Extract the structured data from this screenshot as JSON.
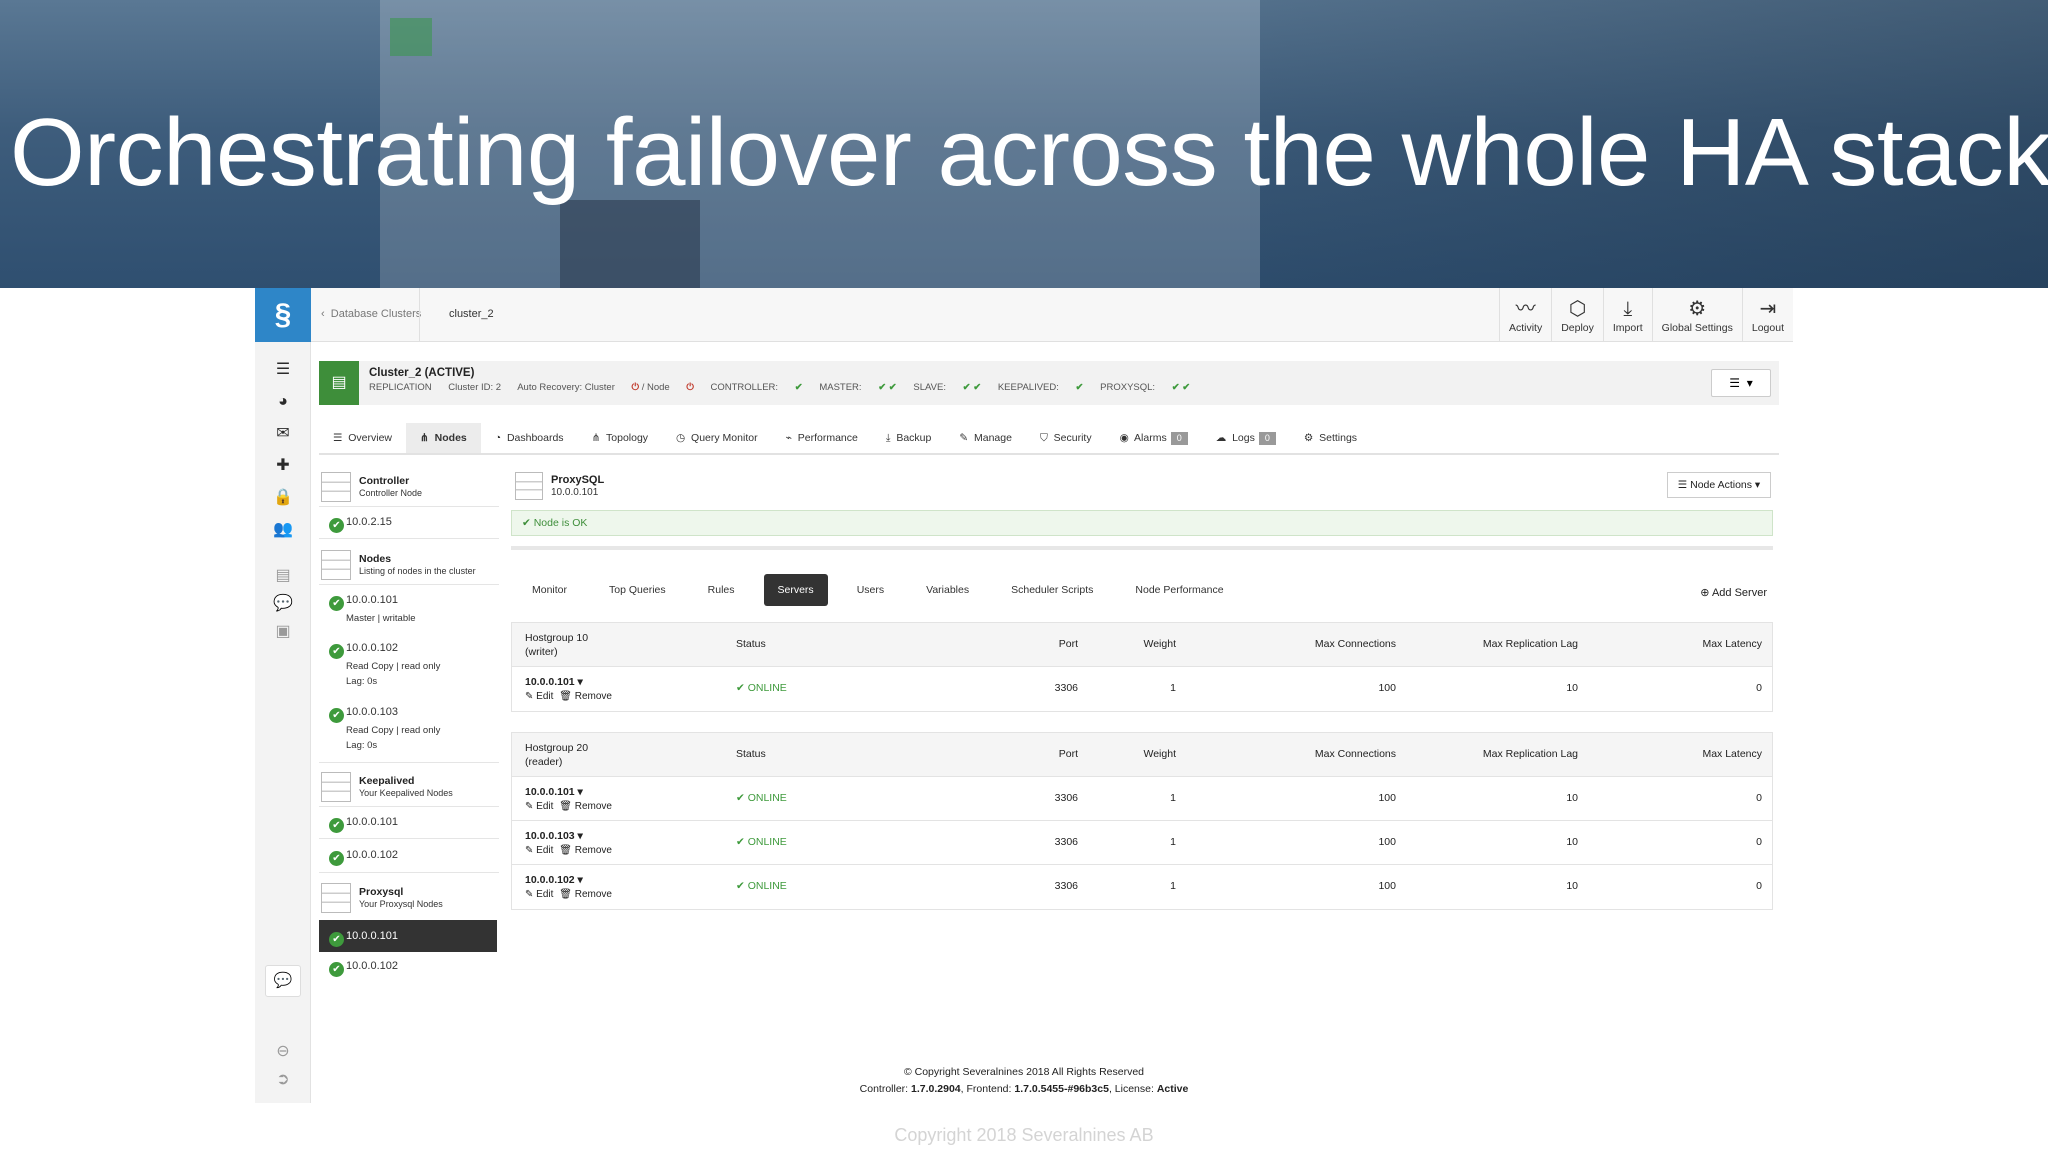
{
  "banner": {
    "title": "Orchestrating failover across the whole HA stack"
  },
  "breadcrumb": {
    "back": "Database Clusters",
    "current": "cluster_2"
  },
  "topnav": [
    {
      "label": "Activity",
      "icon": "activity-icon"
    },
    {
      "label": "Deploy",
      "icon": "deploy-icon"
    },
    {
      "label": "Import",
      "icon": "import-icon"
    },
    {
      "label": "Global Settings",
      "icon": "gears-icon"
    },
    {
      "label": "Logout",
      "icon": "logout-icon"
    }
  ],
  "cluster": {
    "name": "Cluster_2 (ACTIVE)",
    "type": "REPLICATION",
    "id": "Cluster ID: 2",
    "recovery": "Auto Recovery: Cluster",
    "recovery_node": "/ Node",
    "controller": "CONTROLLER:",
    "master": "MASTER:",
    "slave": "SLAVE:",
    "keepalived": "KEEPALIVED:",
    "proxysql": "PROXYSQL:"
  },
  "tabs": [
    {
      "label": "Overview",
      "icon": "list-icon"
    },
    {
      "label": "Nodes",
      "icon": "nodes-icon",
      "active": true
    },
    {
      "label": "Dashboards",
      "icon": "dashboard-icon"
    },
    {
      "label": "Topology",
      "icon": "topology-icon"
    },
    {
      "label": "Query Monitor",
      "icon": "clock-icon"
    },
    {
      "label": "Performance",
      "icon": "chart-icon"
    },
    {
      "label": "Backup",
      "icon": "backup-icon"
    },
    {
      "label": "Manage",
      "icon": "wrench-icon"
    },
    {
      "label": "Security",
      "icon": "shield-icon"
    },
    {
      "label": "Alarms",
      "icon": "alarm-icon",
      "count": "0"
    },
    {
      "label": "Logs",
      "icon": "logs-icon",
      "count": "0"
    },
    {
      "label": "Settings",
      "icon": "gear-icon"
    }
  ],
  "left": {
    "controller": {
      "title": "Controller",
      "sub": "Controller Node",
      "ip": "10.0.2.15"
    },
    "nodes": {
      "title": "Nodes",
      "sub": "Listing of nodes in the cluster",
      "items": [
        {
          "ip": "10.0.0.101",
          "l1": "Master | writable",
          "l2": ""
        },
        {
          "ip": "10.0.0.102",
          "l1": "Read Copy | read only",
          "l2": "Lag: 0s"
        },
        {
          "ip": "10.0.0.103",
          "l1": "Read Copy | read only",
          "l2": "Lag: 0s"
        }
      ]
    },
    "keepalived": {
      "title": "Keepalived",
      "sub": "Your Keepalived Nodes",
      "ips": [
        "10.0.0.101",
        "10.0.0.102"
      ]
    },
    "proxysql": {
      "title": "Proxysql",
      "sub": "Your Proxysql Nodes",
      "ips": [
        "10.0.0.101",
        "10.0.0.102"
      ]
    }
  },
  "panel": {
    "title": "ProxySQL",
    "ip": "10.0.0.101",
    "node_actions": "Node Actions",
    "status": "Node is OK",
    "subtabs": [
      "Monitor",
      "Top Queries",
      "Rules",
      "Servers",
      "Users",
      "Variables",
      "Scheduler Scripts",
      "Node Performance"
    ],
    "active_subtab": "Servers",
    "add_server": "Add Server",
    "columns": {
      "status": "Status",
      "port": "Port",
      "weight": "Weight",
      "maxconn": "Max Connections",
      "maxlag": "Max Replication Lag",
      "maxlat": "Max Latency"
    },
    "edit": "Edit",
    "remove": "Remove",
    "hostgroups": [
      {
        "name": "Hostgroup 10",
        "role": "(writer)",
        "rows": [
          {
            "ip": "10.0.0.101",
            "status": "ONLINE",
            "port": "3306",
            "weight": "1",
            "maxconn": "100",
            "maxlag": "10",
            "maxlat": "0"
          }
        ]
      },
      {
        "name": "Hostgroup 20",
        "role": "(reader)",
        "rows": [
          {
            "ip": "10.0.0.101",
            "status": "ONLINE",
            "port": "3306",
            "weight": "1",
            "maxconn": "100",
            "maxlag": "10",
            "maxlat": "0"
          },
          {
            "ip": "10.0.0.103",
            "status": "ONLINE",
            "port": "3306",
            "weight": "1",
            "maxconn": "100",
            "maxlag": "10",
            "maxlat": "0"
          },
          {
            "ip": "10.0.0.102",
            "status": "ONLINE",
            "port": "3306",
            "weight": "1",
            "maxconn": "100",
            "maxlag": "10",
            "maxlat": "0"
          }
        ]
      }
    ]
  },
  "footer": {
    "copyright": "© Copyright Severalnines 2018 All Rights Reserved",
    "controller_label": "Controller:",
    "controller_ver": "1.7.0.2904",
    "frontend_label": ", Frontend:",
    "frontend_ver": "1.7.0.5455-#96b3c5",
    "license_label": ", License:",
    "license": "Active"
  },
  "watermark": "Copyright 2018 Severalnines AB",
  "colors": {
    "accent": "#2e86c8",
    "ok": "#3e9a3c",
    "cluster_badge": "#3e8e3a"
  }
}
